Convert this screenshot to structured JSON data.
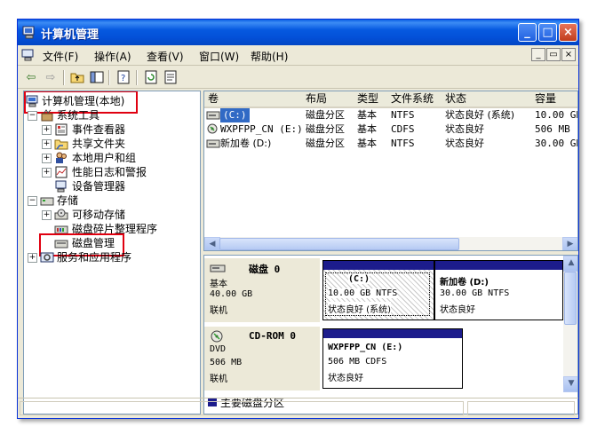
{
  "window": {
    "title": "计算机管理",
    "buttons": {
      "minimize": "_",
      "maximize": "□",
      "close": "×"
    }
  },
  "menubar": {
    "items": [
      "文件(F)",
      "操作(A)",
      "查看(V)",
      "窗口(W)",
      "帮助(H)"
    ],
    "mdi": {
      "minimize": "_",
      "restore": "▭",
      "close": "×"
    }
  },
  "toolbar": {
    "icons": [
      "back-icon",
      "forward-icon",
      "up-folder-icon",
      "show-hide-tree-icon",
      "help-icon",
      "refresh-icon",
      "properties-icon"
    ]
  },
  "tree": {
    "root": "计算机管理(本地)",
    "nodes": [
      {
        "label": "系统工具",
        "level": 1,
        "expander": "−",
        "icon": "tools-icon"
      },
      {
        "label": "事件查看器",
        "level": 2,
        "expander": "+",
        "icon": "event-viewer-icon"
      },
      {
        "label": "共享文件夹",
        "level": 2,
        "expander": "+",
        "icon": "shared-folder-icon"
      },
      {
        "label": "本地用户和组",
        "level": 2,
        "expander": "+",
        "icon": "users-icon"
      },
      {
        "label": "性能日志和警报",
        "level": 2,
        "expander": "+",
        "icon": "performance-icon"
      },
      {
        "label": "设备管理器",
        "level": 2,
        "expander": "",
        "icon": "device-manager-icon"
      },
      {
        "label": "存储",
        "level": 1,
        "expander": "−",
        "icon": "storage-icon"
      },
      {
        "label": "可移动存储",
        "level": 2,
        "expander": "+",
        "icon": "removable-storage-icon"
      },
      {
        "label": "磁盘碎片整理程序",
        "level": 2,
        "expander": "",
        "icon": "defrag-icon"
      },
      {
        "label": "磁盘管理",
        "level": 2,
        "expander": "",
        "icon": "disk-management-icon"
      },
      {
        "label": "服务和应用程序",
        "level": 1,
        "expander": "+",
        "icon": "services-icon"
      }
    ]
  },
  "volumes": {
    "columns": [
      "卷",
      "布局",
      "类型",
      "文件系统",
      "状态",
      "容量"
    ],
    "rows": [
      {
        "volume": "(C:)",
        "layout": "磁盘分区",
        "type": "基本",
        "fs": "NTFS",
        "status": "状态良好 (系统)",
        "capacity": "10.00 GB",
        "icon": "hard-disk-icon",
        "selected": true
      },
      {
        "volume": "WXPFPP_CN (E:)",
        "layout": "磁盘分区",
        "type": "基本",
        "fs": "CDFS",
        "status": "状态良好",
        "capacity": "506 MB",
        "icon": "cd-icon",
        "selected": false
      },
      {
        "volume": "新加卷 (D:)",
        "layout": "磁盘分区",
        "type": "基本",
        "fs": "NTFS",
        "status": "状态良好",
        "capacity": "30.00 GB",
        "icon": "hard-disk-icon",
        "selected": false
      }
    ]
  },
  "disks": [
    {
      "name": "磁盘 0",
      "kind": "基本",
      "size": "40.00 GB",
      "state": "联机",
      "partitions": [
        {
          "title": "(C:)",
          "detail": "10.00 GB NTFS",
          "status": "状态良好 (系统)"
        },
        {
          "title": "新加卷  (D:)",
          "detail": "30.00 GB NTFS",
          "status": "状态良好"
        }
      ]
    },
    {
      "name": "CD-ROM 0",
      "kind": "DVD",
      "size": "506 MB",
      "state": "联机",
      "partitions": [
        {
          "title": "WXPFPP_CN  (E:)",
          "detail": "506 MB CDFS",
          "status": "状态良好"
        }
      ]
    }
  ],
  "legend": {
    "primary_partition": "主要磁盘分区"
  },
  "colors": {
    "title_blue": "#0a5ee3",
    "partition_bar": "#1c1c8c",
    "highlight_red": "#e00010"
  }
}
